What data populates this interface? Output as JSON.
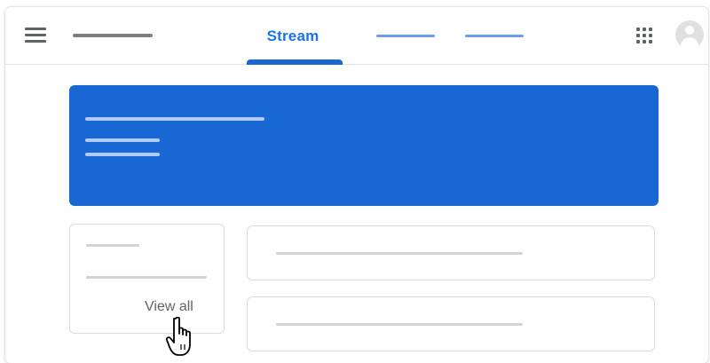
{
  "header": {
    "menu_icon": "hamburger-menu-icon",
    "tabs": [
      {
        "label": "Stream",
        "active": true
      }
    ],
    "apps_icon": "apps-grid-icon",
    "avatar_icon": "account-avatar-icon",
    "accent_color": "#1a73e8"
  },
  "banner": {
    "color": "#1967d2"
  },
  "upcoming": {
    "view_all_label": "View all"
  },
  "cursor_icon": "hand-pointer-cursor-icon"
}
